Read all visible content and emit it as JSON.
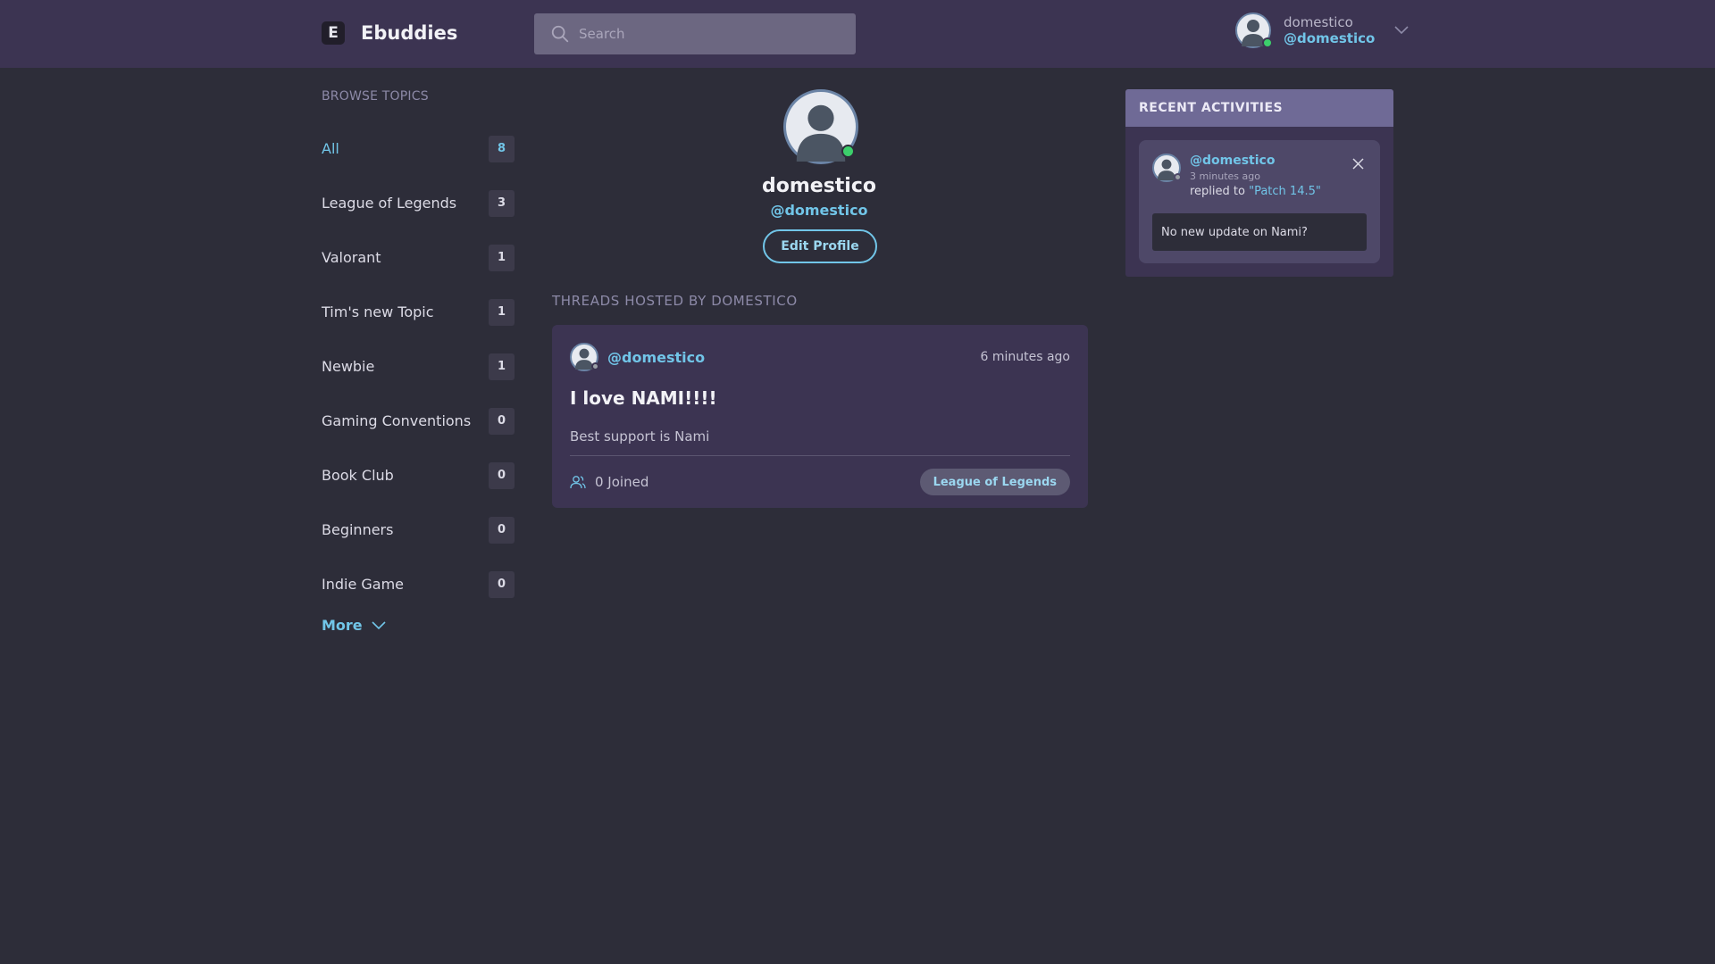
{
  "header": {
    "app_title": "Ebuddies",
    "logo_letter": "E",
    "search_placeholder": "Search",
    "user": {
      "name": "domestico",
      "handle": "@domestico"
    }
  },
  "sidebar": {
    "title": "BROWSE TOPICS",
    "topics": [
      {
        "label": "All",
        "count": "8"
      },
      {
        "label": "League of Legends",
        "count": "3"
      },
      {
        "label": "Valorant",
        "count": "1"
      },
      {
        "label": "Tim's new Topic",
        "count": "1"
      },
      {
        "label": "Newbie",
        "count": "1"
      },
      {
        "label": "Gaming Conventions",
        "count": "0"
      },
      {
        "label": "Book Club",
        "count": "0"
      },
      {
        "label": "Beginners",
        "count": "0"
      },
      {
        "label": "Indie Game",
        "count": "0"
      }
    ],
    "more_label": "More"
  },
  "profile": {
    "name": "domestico",
    "handle": "@domestico",
    "edit_label": "Edit Profile",
    "threads_title": "THREADS HOSTED BY DOMESTICO"
  },
  "thread": {
    "author": "@domestico",
    "time": "6 minutes ago",
    "title": "I love NAMI!!!!",
    "body": "Best support is Nami",
    "joined": "0 Joined",
    "tag": "League of Legends"
  },
  "recent": {
    "title": "RECENT ACTIVITIES",
    "activity": {
      "user": "@domestico",
      "time": "3 minutes ago",
      "action": "replied to",
      "target": "\"Patch 14.5\"",
      "snippet": "No new update on Nami?"
    }
  },
  "colors": {
    "accent": "#71c5e8",
    "header_bg": "#3c3452",
    "page_bg": "#2d2d39",
    "online": "#3ccf6b"
  },
  "icons": [
    "logo-icon",
    "search-icon",
    "avatar",
    "chevron-down-icon",
    "users-icon",
    "close-icon"
  ]
}
